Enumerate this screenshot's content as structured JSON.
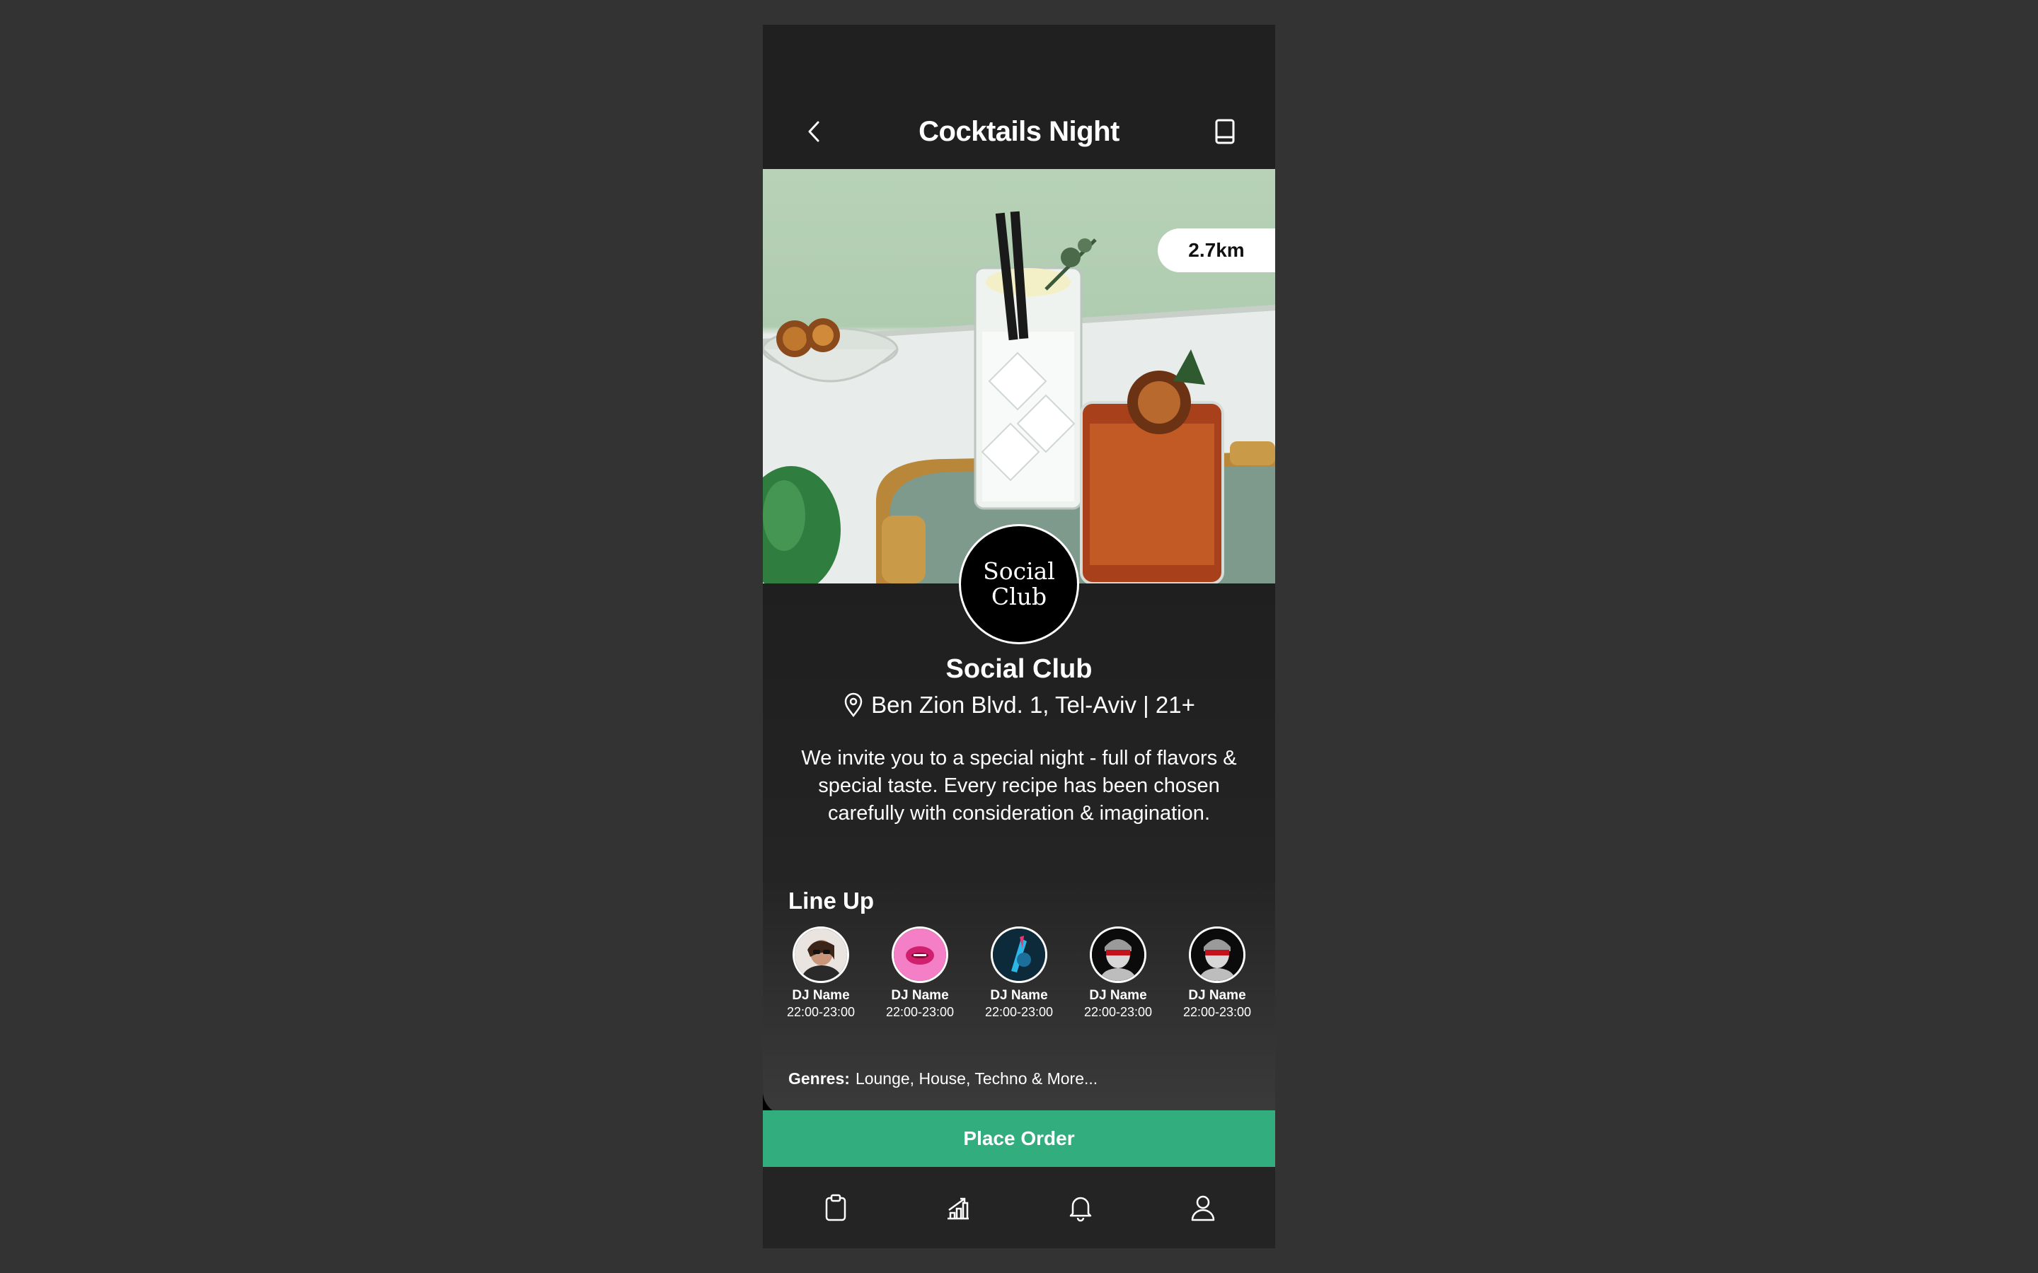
{
  "header": {
    "title": "Cocktails Night",
    "back_icon": "chevron-left-icon",
    "menu_icon": "book-icon"
  },
  "hero": {
    "distance": "2.7km"
  },
  "venue": {
    "logo_line1": "Social",
    "logo_line2": "Club",
    "name": "Social Club",
    "address": "Ben Zion Blvd. 1, Tel-Aviv | 21+",
    "description": "We invite you to a special night - full of flavors & special taste. Every recipe has been chosen carefully with consideration & imagination."
  },
  "lineup": {
    "heading": "Line Up",
    "djs": [
      {
        "name": "DJ Name",
        "time": "22:00-23:00"
      },
      {
        "name": "DJ Name",
        "time": "22:00-23:00"
      },
      {
        "name": "DJ Name",
        "time": "22:00-23:00"
      },
      {
        "name": "DJ Name",
        "time": "22:00-23:00"
      },
      {
        "name": "DJ Name",
        "time": "22:00-23:00"
      }
    ],
    "genres_label": "Genres:",
    "genres_value": "Lounge, House, Techno & More..."
  },
  "actions": {
    "place_order": "Place Order"
  },
  "tabbar": {
    "tabs": [
      "clipboard-icon",
      "chart-icon",
      "bell-icon",
      "user-icon"
    ]
  },
  "colors": {
    "accent": "#31ad7e",
    "background": "#333333",
    "header": "#202020"
  }
}
